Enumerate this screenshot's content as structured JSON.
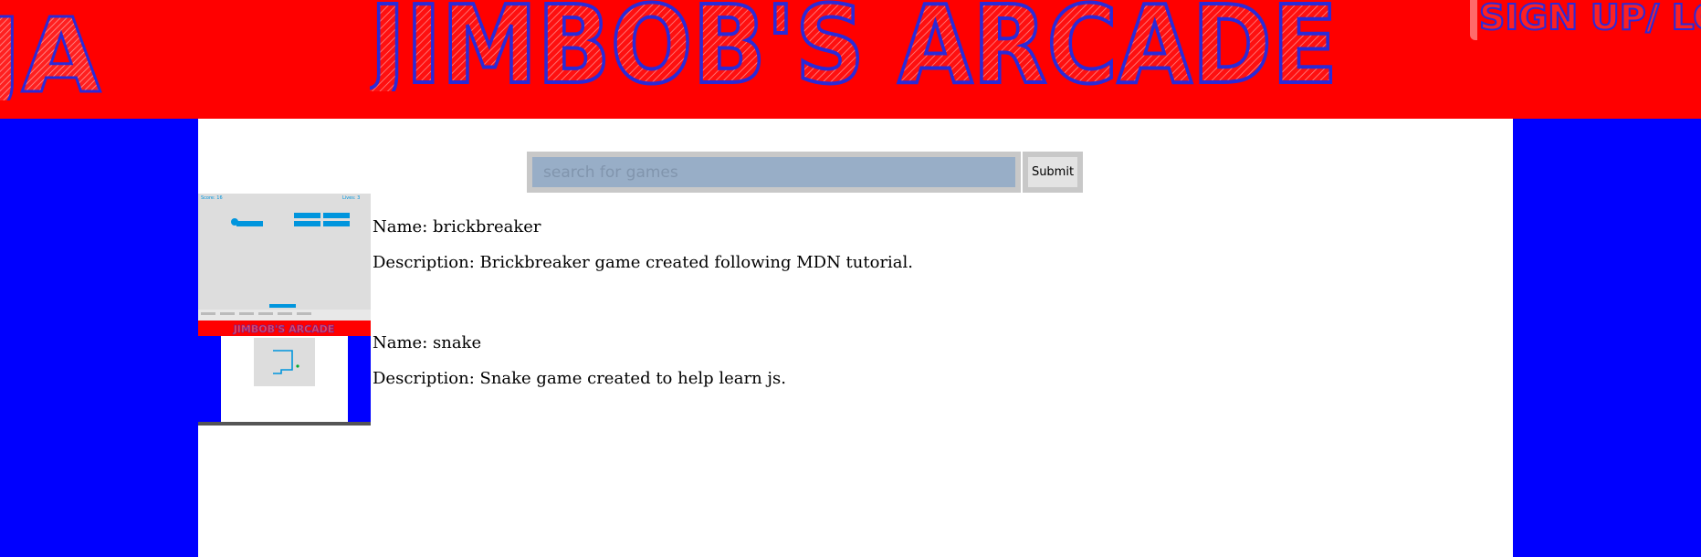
{
  "header": {
    "logo_text": "JA",
    "site_title": "JIMBOB'S ARCADE",
    "signup_login": "SIGN UP/ LOG"
  },
  "search": {
    "placeholder": "search for games",
    "value": "",
    "submit_label": "Submit"
  },
  "games": [
    {
      "name": "Name: brickbreaker",
      "description": "Description: Brickbreaker game created following MDN tutorial.",
      "thumbnail": {
        "score_text": "Score: 16",
        "lives_text": "Lives: 3"
      }
    },
    {
      "name": "Name: snake",
      "description": "Description: Snake game created to help learn js.",
      "thumbnail": {
        "title_text": "JIMBOB'S ARCADE"
      }
    }
  ],
  "colors": {
    "header_bg": "#ff0000",
    "side_bg": "#0000ff",
    "title_outline": "#2a2ad8",
    "brick_blue": "#0095dd",
    "thumb_bg": "#dddddd",
    "search_bg": "#98aec7"
  }
}
